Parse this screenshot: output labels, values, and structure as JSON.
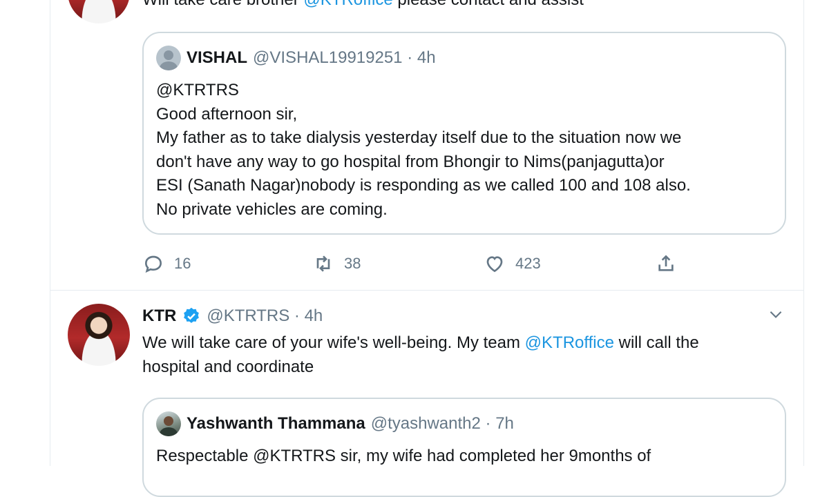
{
  "prev_tweet": {
    "reply_prefix": "Will take care brother ",
    "mention": "@KTRoffice",
    "reply_suffix": " please contact and assist",
    "quote": {
      "name": "VISHAL",
      "handle_time": "@VISHAL19919251 · 4h",
      "lines": [
        "@KTRTRS",
        "Good afternoon sir,",
        "My father as to take dialysis  yesterday itself due to the situation now we",
        "don't have any way to go hospital from Bhongir to Nims(panjagutta)or",
        "ESI (Sanath Nagar)nobody is responding as we called 100 and 108 also.",
        "No private vehicles are coming."
      ]
    },
    "actions": {
      "reply_count": "16",
      "retweet_count": "38",
      "like_count": "423"
    }
  },
  "tweet": {
    "name": "KTR",
    "handle_time": "@KTRTRS · 4h",
    "line1_prefix": "We will take care of your wife's well-being. My team ",
    "line1_mention": "@KTRoffice",
    "line1_suffix": " will call the",
    "line2": "hospital and coordinate",
    "quote": {
      "name": "Yashwanth Thammana",
      "handle_time": "@tyashwanth2 · 7h",
      "line1": "Respectable @KTRTRS sir, my wife had completed her 9months of"
    }
  },
  "icons": {
    "reply": "reply-icon",
    "retweet": "retweet-icon",
    "like": "heart-icon",
    "share": "share-icon",
    "verified": "verified-badge-icon",
    "more": "chevron-down-icon"
  },
  "colors": {
    "link": "#1b95e0",
    "verified": "#1da1f2",
    "muted": "#657786",
    "border": "#cfd9de"
  }
}
